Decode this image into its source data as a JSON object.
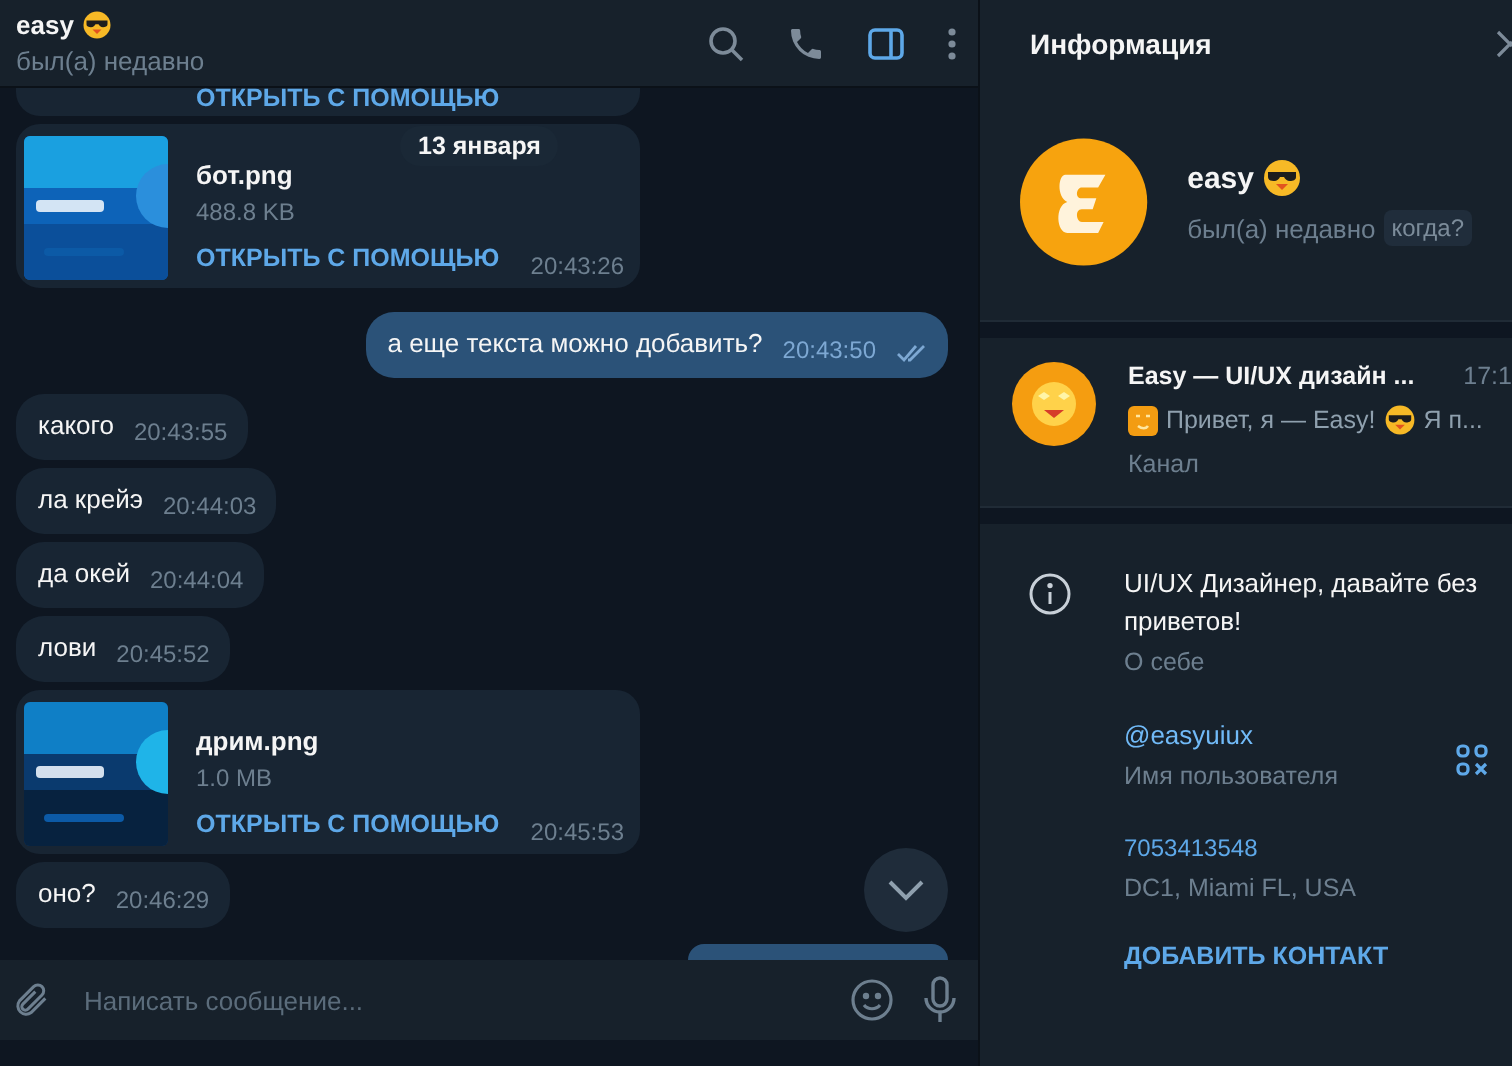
{
  "chat": {
    "title": "easy",
    "status": "был(а) недавно",
    "info_panel_open": true
  },
  "date_badge": "13 января",
  "messages": [
    {
      "kind": "file_tail",
      "action": "ОТКРЫТЬ С ПОМОЩЬЮ"
    },
    {
      "kind": "file",
      "name": "бот.png",
      "size": "488.8 KB",
      "action": "ОТКРЫТЬ С ПОМОЩЬЮ",
      "time": "20:43:26"
    },
    {
      "kind": "outgoing",
      "text": "а еще текста можно добавить?",
      "time": "20:43:50",
      "read": true
    },
    {
      "kind": "text",
      "text": "какого",
      "time": "20:43:55"
    },
    {
      "kind": "text",
      "text": "ла крейэ",
      "time": "20:44:03"
    },
    {
      "kind": "text",
      "text": "да окей",
      "time": "20:44:04"
    },
    {
      "kind": "text",
      "text": "лови",
      "time": "20:45:52"
    },
    {
      "kind": "file",
      "name": "дрим.png",
      "size": "1.0 MB",
      "action": "ОТКРЫТЬ С ПОМОЩЬЮ",
      "time": "20:45:53"
    },
    {
      "kind": "text",
      "text": "оно?",
      "time": "20:46:29"
    },
    {
      "kind": "outgoing_tail"
    }
  ],
  "compose": {
    "placeholder": "Написать сообщение..."
  },
  "info": {
    "title": "Информация",
    "name": "easy",
    "status": "был(а) недавно",
    "last_seen_hint": "когда?",
    "channel": {
      "title": "Easy — UI/UX дизайн ...",
      "time": "17:1",
      "preview_start": "Привет, я — Easy!",
      "preview_end": "Я п...",
      "type": "Канал"
    },
    "about": {
      "text": "UI/UX Дизайнер, давайте без приветов!",
      "label": "О себе"
    },
    "username": {
      "value": "@easyuiux",
      "label": "Имя пользователя"
    },
    "phone": {
      "value": "7053413548",
      "label": "DC1, Miami FL, USA"
    },
    "add_contact": "ДОБАВИТЬ КОНТАКТ"
  }
}
